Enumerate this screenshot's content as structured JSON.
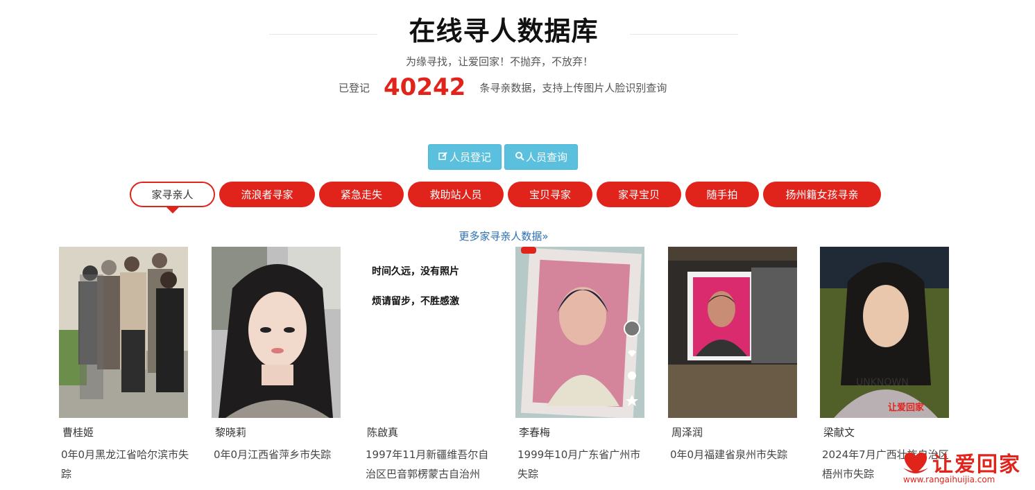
{
  "header": {
    "title": "在线寻人数据库",
    "subtitle": "为缘寻找，让爱回家！不抛弃，不放弃！",
    "stats_prefix": "已登记",
    "stats_count": "40242",
    "stats_suffix": "条寻亲数据，支持上传图片人脸识别查询"
  },
  "actions": {
    "register_label": "人员登记",
    "search_label": "人员查询"
  },
  "tabs": [
    {
      "label": "家寻亲人",
      "active": true
    },
    {
      "label": "流浪者寻家"
    },
    {
      "label": "紧急走失"
    },
    {
      "label": "救助站人员"
    },
    {
      "label": "宝贝寻家"
    },
    {
      "label": "家寻宝贝"
    },
    {
      "label": "随手拍"
    },
    {
      "label": "扬州籍女孩寻亲"
    }
  ],
  "more_link": "更多家寻亲人数据»",
  "cards": [
    {
      "name": "曹桂姬",
      "desc": "0年0月黑龙江省哈尔滨市失踪"
    },
    {
      "name": "黎晓莉",
      "desc": "0年0月江西省萍乡市失踪"
    },
    {
      "name": "陈啟真",
      "desc": "1997年11月新疆维吾尔自治区巴音郭楞蒙古自治州",
      "no_photo_line1": "时间久远，没有照片",
      "no_photo_line2": "烦请留步，不胜感激"
    },
    {
      "name": "李春梅",
      "desc": "1999年10月广东省广州市失踪"
    },
    {
      "name": "周泽润",
      "desc": "0年0月福建省泉州市失踪"
    },
    {
      "name": "梁献文",
      "desc": "2024年7月广西壮族自治区梧州市失踪",
      "photo_text": "UNKNOWN",
      "watermark": "让爱回家"
    }
  ],
  "logo": {
    "text": "让爱回家",
    "url": "www.rangaihuijia.com"
  },
  "colors": {
    "accent": "#e0231b",
    "info": "#5bc0de",
    "link": "#2a6fb3"
  }
}
